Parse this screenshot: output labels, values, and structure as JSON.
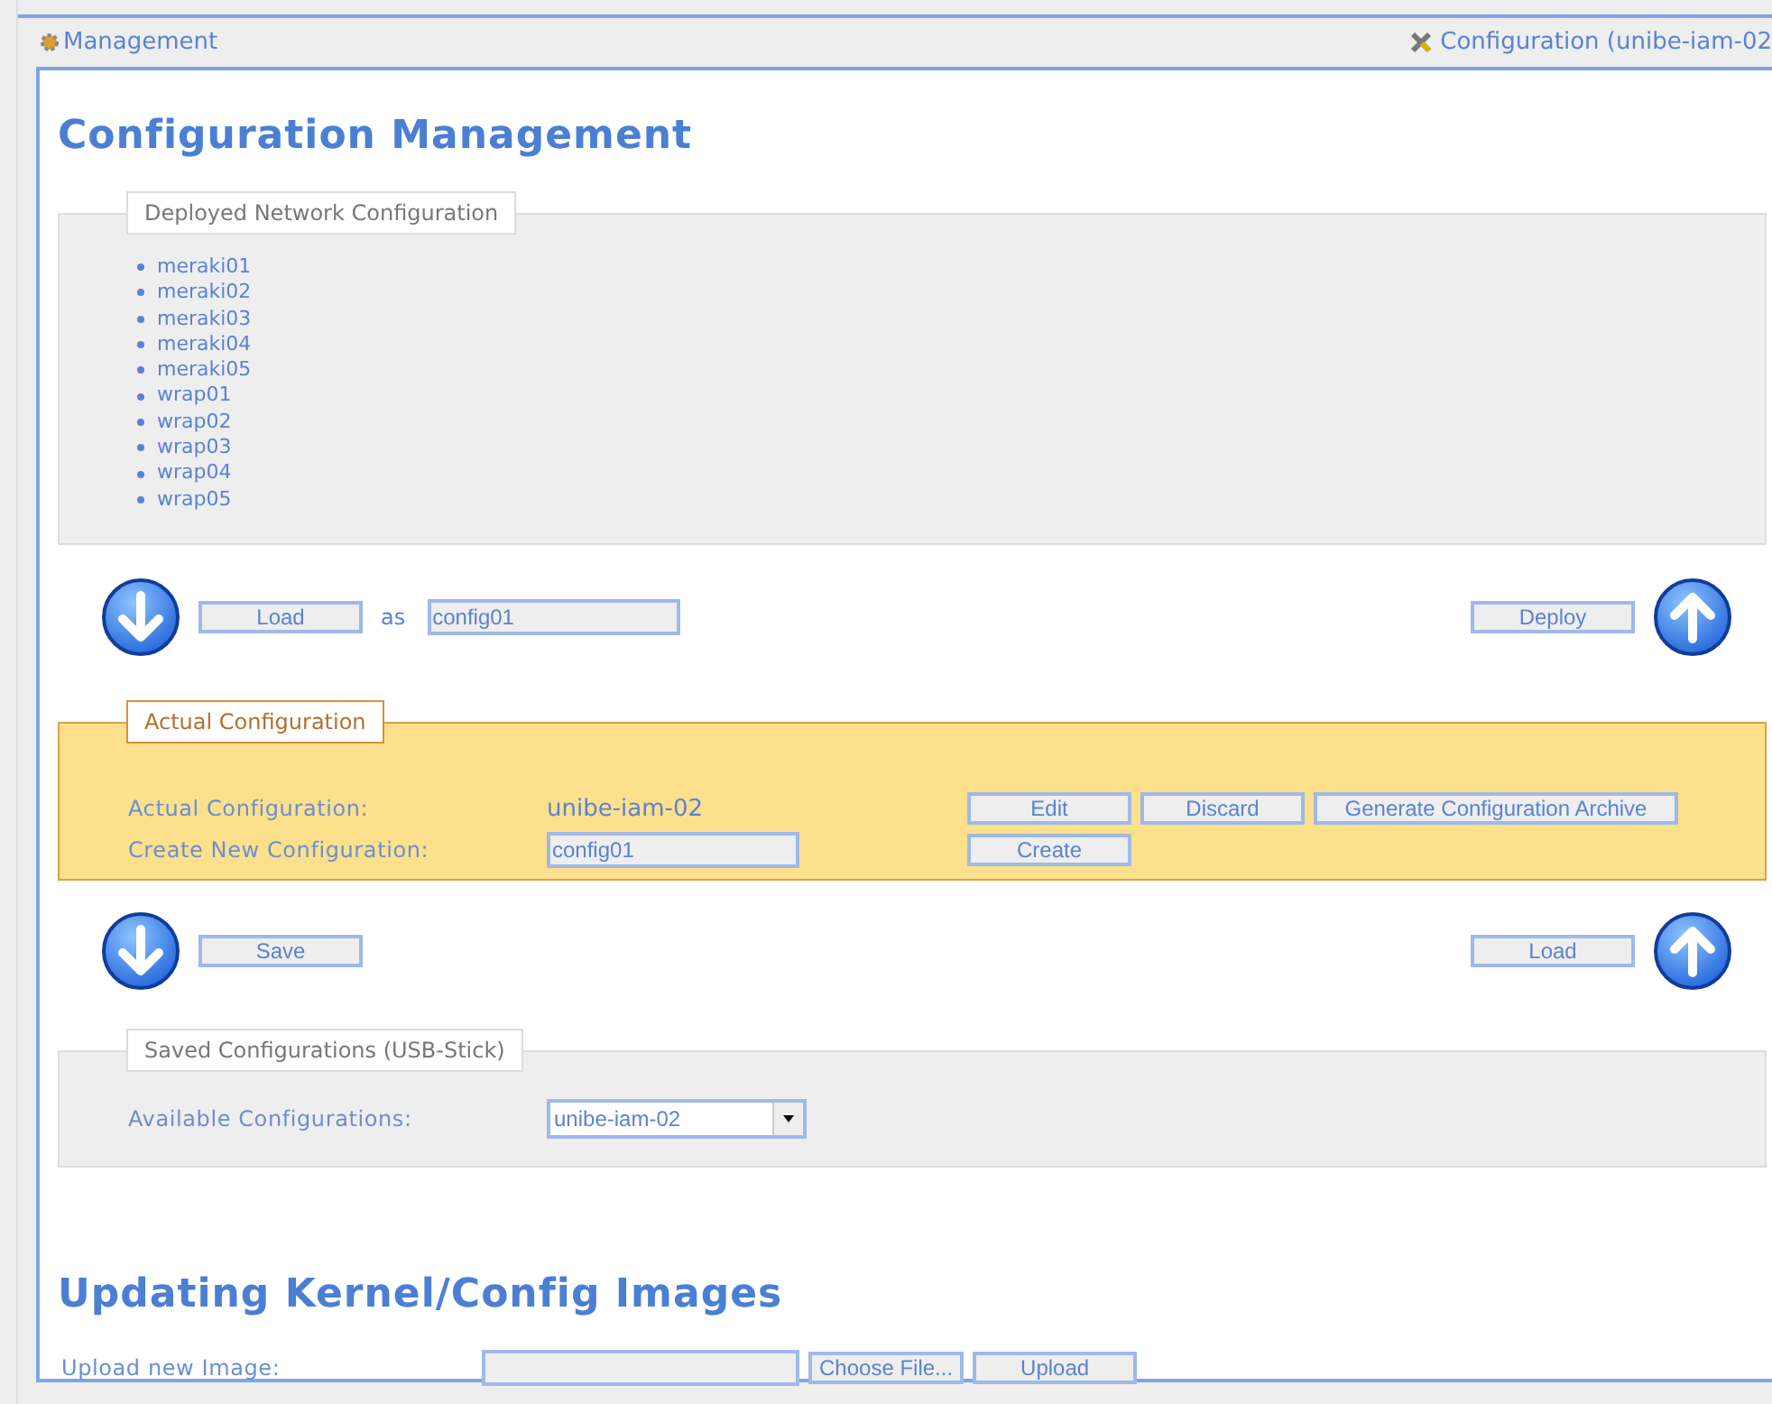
{
  "header": {
    "title": "Management",
    "context": "Configuration (unibe-iam-02"
  },
  "heading": "Configuration Management",
  "deployed": {
    "legend": "Deployed Network Configuration",
    "items": [
      "meraki01",
      "meraki02",
      "meraki03",
      "meraki04",
      "meraki05",
      "wrap01",
      "wrap02",
      "wrap03",
      "wrap04",
      "wrap05"
    ]
  },
  "transfer_top": {
    "load_button": "Load",
    "as_label": "as",
    "name_value": "config01",
    "deploy_button": "Deploy"
  },
  "actual": {
    "legend": "Actual Configuration",
    "actual_label": "Actual Configuration:",
    "actual_value": "unibe-iam-02",
    "create_label": "Create New Configuration:",
    "create_value": "config01",
    "buttons": [
      "Edit",
      "Discard",
      "Generate Configuration Archive"
    ],
    "create_button": "Create"
  },
  "transfer_bottom": {
    "save_button": "Save",
    "load_button": "Load"
  },
  "saved": {
    "legend": "Saved Configurations (USB-Stick)",
    "label": "Available Configurations:",
    "selected_value": "unibe-iam-02"
  },
  "updating": {
    "heading": "Updating Kernel/Config Images",
    "label": "Upload new Image:",
    "choose_button": "Choose File...",
    "upload_button": "Upload"
  }
}
